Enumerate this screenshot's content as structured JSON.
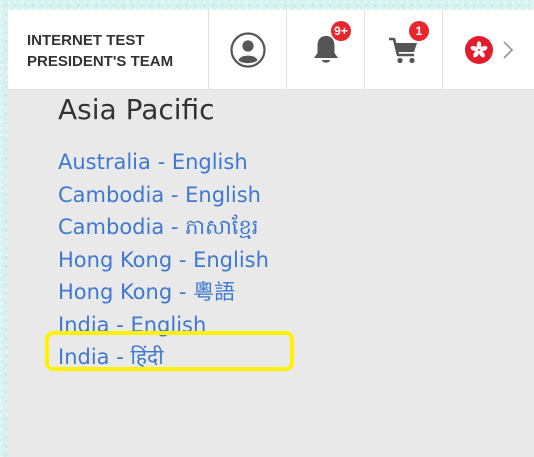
{
  "header": {
    "brand_lines": [
      "INTERNET TEST",
      "PRESIDENT'S TEAM"
    ],
    "notifications": {
      "icon": "bell-icon",
      "badge": "9+"
    },
    "cart": {
      "icon": "cart-icon",
      "badge": "1"
    },
    "account": {
      "icon": "user-icon"
    },
    "locale": {
      "icon": "hong-kong-flag-icon"
    },
    "more": {
      "icon": "chevron-right-icon"
    }
  },
  "region": {
    "title": "Asia Pacific",
    "countries": [
      "Australia - English",
      "Cambodia - English",
      "Cambodia - ភាសាខ្មែរ",
      "Hong Kong - English",
      "Hong Kong - 粵語",
      "India - English",
      "India - हिंदी"
    ]
  },
  "colors": {
    "link": "#3f78d1",
    "badge": "#e8262d",
    "highlight": "#fff200",
    "panel_background": "#e9e9e9",
    "page_background": "#d7f2f1"
  }
}
